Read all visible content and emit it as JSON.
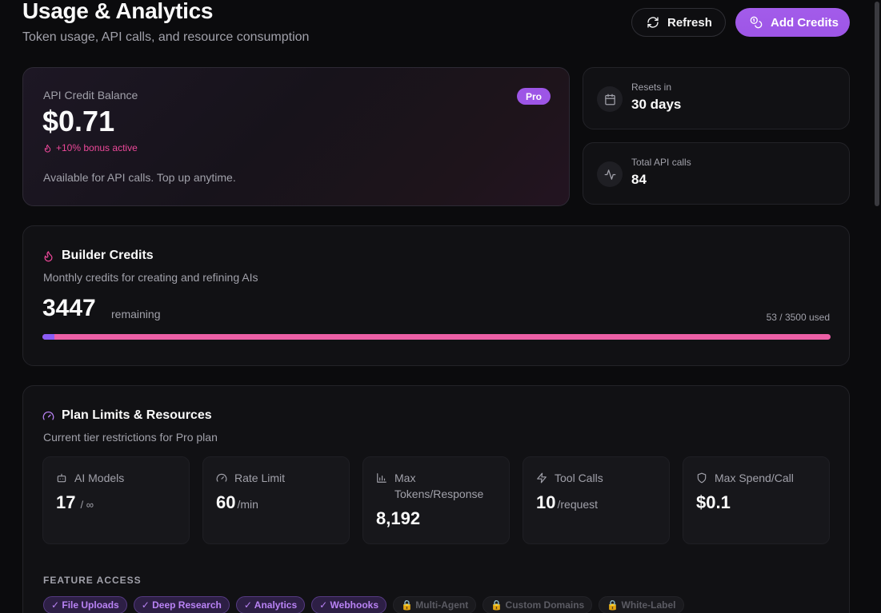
{
  "header": {
    "title": "Usage & Analytics",
    "subtitle": "Token usage, API calls, and resource consumption",
    "refresh_label": "Refresh",
    "add_credits_label": "Add Credits"
  },
  "balance": {
    "label": "API Credit Balance",
    "amount": "$0.71",
    "bonus": "+10% bonus active",
    "note": "Available for API calls. Top up anytime.",
    "badge": "Pro"
  },
  "stats": {
    "resets_label": "Resets in",
    "resets_value": "30 days",
    "calls_label": "Total API calls",
    "calls_value": "84"
  },
  "builder": {
    "title": "Builder Credits",
    "subtitle": "Monthly credits for creating and refining AIs",
    "remaining": "3447",
    "remaining_label": "remaining",
    "used_label": "53 / 3500 used",
    "used_fraction": 0.0151
  },
  "limits": {
    "title": "Plan Limits & Resources",
    "subtitle": "Current tier restrictions for Pro plan",
    "tiles": [
      {
        "label": "AI Models",
        "value": "17",
        "unit": "/ ∞",
        "icon": "bot-icon"
      },
      {
        "label": "Rate Limit",
        "value": "60",
        "unit": "/min",
        "icon": "gauge-icon"
      },
      {
        "label": "Max Tokens/Response",
        "value": "8,192",
        "unit": "",
        "icon": "bar-chart-icon"
      },
      {
        "label": "Tool Calls",
        "value": "10",
        "unit": "/request",
        "icon": "zap-icon"
      },
      {
        "label": "Max Spend/Call",
        "value": "$0.1",
        "unit": "",
        "icon": "shield-icon"
      }
    ],
    "feature_heading": "FEATURE ACCESS",
    "features": [
      {
        "label": "✓ File Uploads",
        "enabled": true
      },
      {
        "label": "✓ Deep Research",
        "enabled": true
      },
      {
        "label": "✓ Analytics",
        "enabled": true
      },
      {
        "label": "✓ Webhooks",
        "enabled": true
      },
      {
        "label": "🔒 Multi-Agent",
        "enabled": false
      },
      {
        "label": "🔒 Custom Domains",
        "enabled": false
      },
      {
        "label": "🔒 White-Label",
        "enabled": false
      }
    ]
  },
  "colors": {
    "accent_purple": "#9d55e6",
    "accent_pink": "#ec4899",
    "background": "#0b0b0d"
  }
}
